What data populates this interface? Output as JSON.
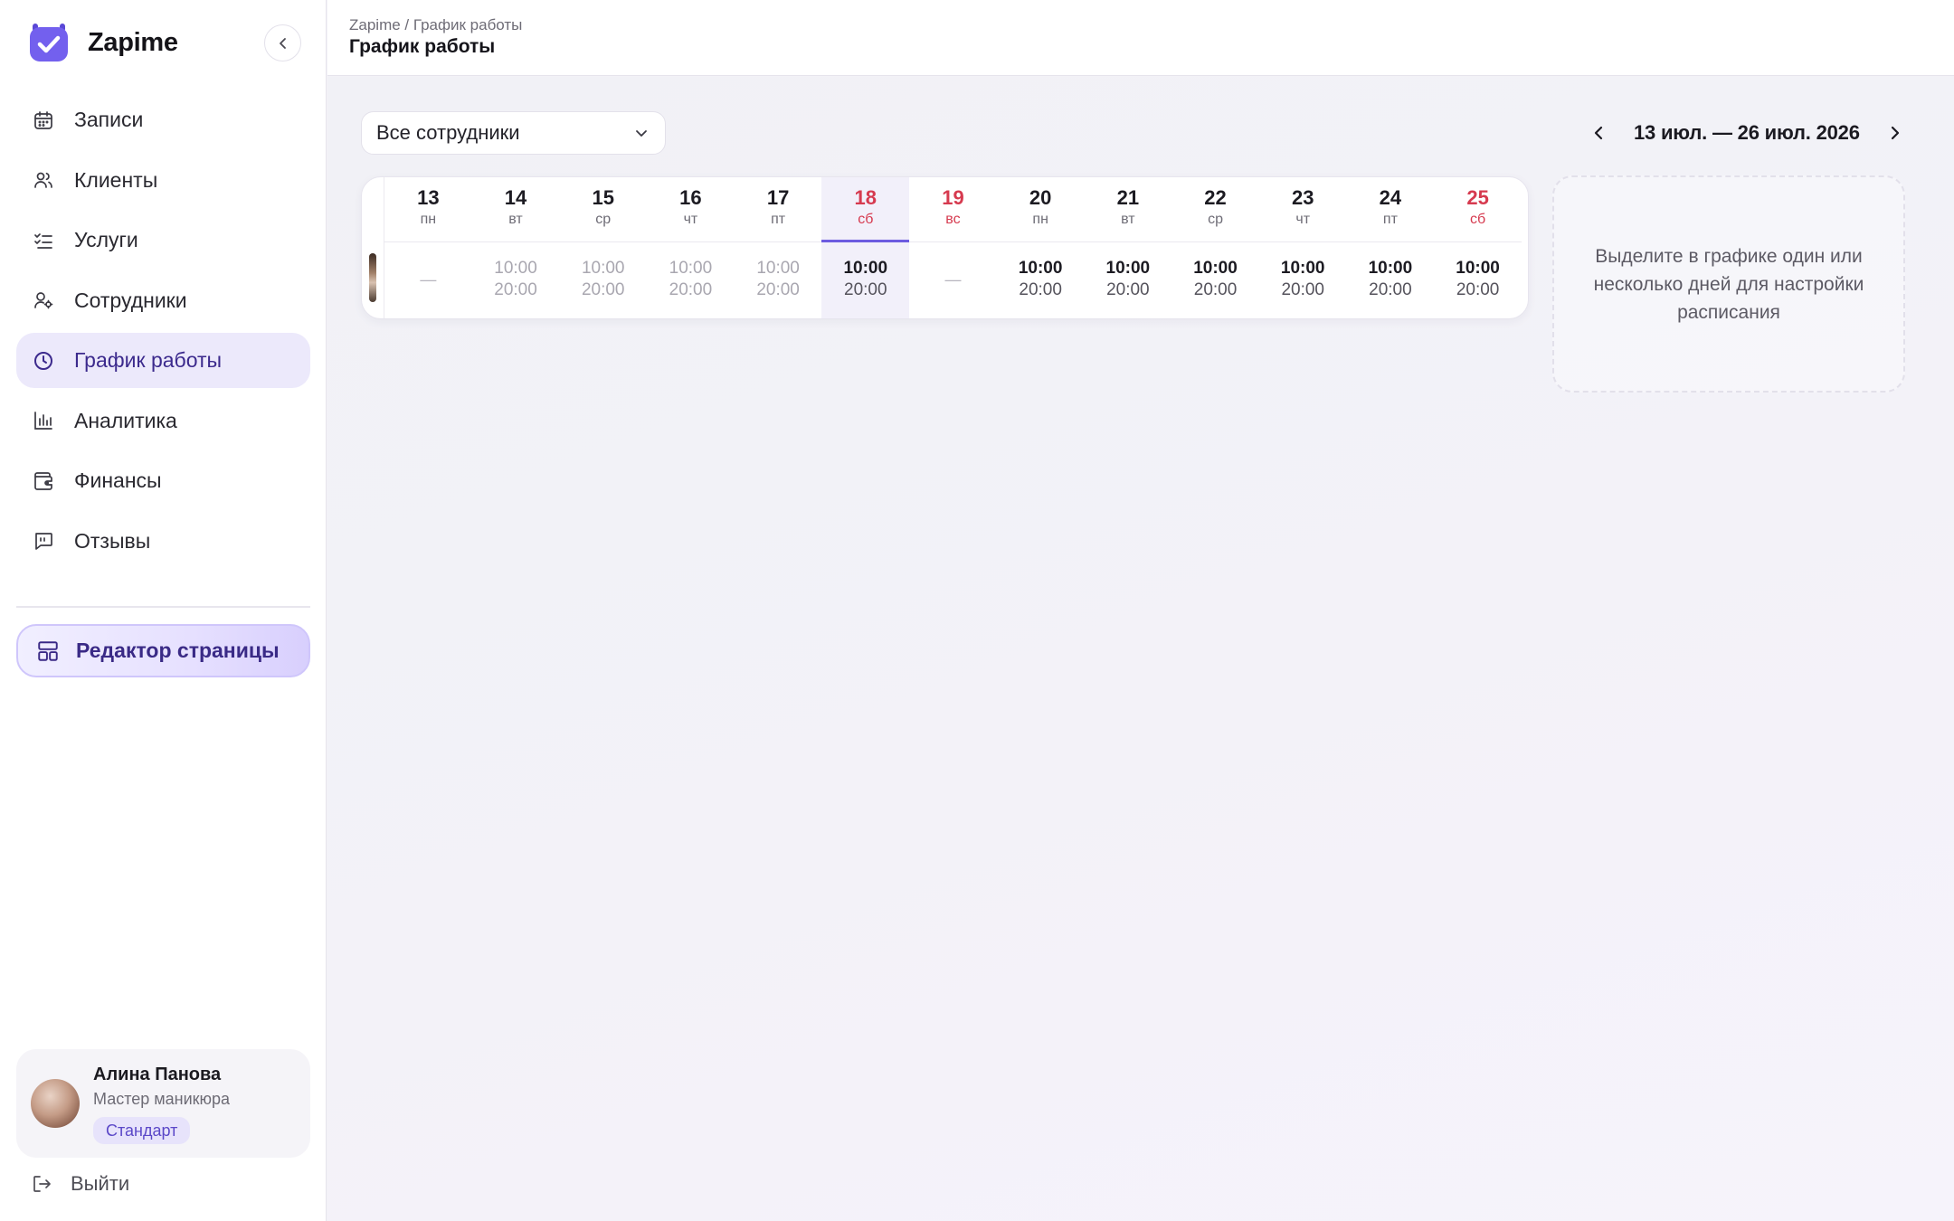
{
  "app": {
    "name": "Zapime"
  },
  "sidebar": {
    "items": [
      {
        "label": "Записи",
        "icon": "calendar-icon",
        "active": false
      },
      {
        "label": "Клиенты",
        "icon": "users-icon",
        "active": false
      },
      {
        "label": "Услуги",
        "icon": "checklist-icon",
        "active": false
      },
      {
        "label": "Сотрудники",
        "icon": "user-settings-icon",
        "active": false
      },
      {
        "label": "График работы",
        "icon": "clock-icon",
        "active": true
      },
      {
        "label": "Аналитика",
        "icon": "bar-chart-icon",
        "active": false
      },
      {
        "label": "Финансы",
        "icon": "wallet-icon",
        "active": false
      },
      {
        "label": "Отзывы",
        "icon": "message-quote-icon",
        "active": false
      }
    ],
    "editor_button": "Редактор страницы",
    "user": {
      "name": "Алина Панова",
      "role": "Мастер маникюра",
      "plan": "Стандарт"
    },
    "logout": "Выйти"
  },
  "header": {
    "breadcrumb": "Zapime / График работы",
    "title": "График работы"
  },
  "filters": {
    "employee_select": "Все сотрудники"
  },
  "range": {
    "label": "13 июл. — 26 июл. 2026"
  },
  "schedule": {
    "days": [
      {
        "num": "13",
        "dow": "пн",
        "start": "",
        "end": "",
        "off": true,
        "past": true,
        "weekend": false,
        "selected": false
      },
      {
        "num": "14",
        "dow": "вт",
        "start": "10:00",
        "end": "20:00",
        "off": false,
        "past": true,
        "weekend": false,
        "selected": false
      },
      {
        "num": "15",
        "dow": "ср",
        "start": "10:00",
        "end": "20:00",
        "off": false,
        "past": true,
        "weekend": false,
        "selected": false
      },
      {
        "num": "16",
        "dow": "чт",
        "start": "10:00",
        "end": "20:00",
        "off": false,
        "past": true,
        "weekend": false,
        "selected": false
      },
      {
        "num": "17",
        "dow": "пт",
        "start": "10:00",
        "end": "20:00",
        "off": false,
        "past": true,
        "weekend": false,
        "selected": false
      },
      {
        "num": "18",
        "dow": "сб",
        "start": "10:00",
        "end": "20:00",
        "off": false,
        "past": false,
        "weekend": true,
        "selected": true
      },
      {
        "num": "19",
        "dow": "вс",
        "start": "",
        "end": "",
        "off": true,
        "past": false,
        "weekend": true,
        "selected": false
      },
      {
        "num": "20",
        "dow": "пн",
        "start": "10:00",
        "end": "20:00",
        "off": false,
        "past": false,
        "weekend": false,
        "selected": false
      },
      {
        "num": "21",
        "dow": "вт",
        "start": "10:00",
        "end": "20:00",
        "off": false,
        "past": false,
        "weekend": false,
        "selected": false
      },
      {
        "num": "22",
        "dow": "ср",
        "start": "10:00",
        "end": "20:00",
        "off": false,
        "past": false,
        "weekend": false,
        "selected": false
      },
      {
        "num": "23",
        "dow": "чт",
        "start": "10:00",
        "end": "20:00",
        "off": false,
        "past": false,
        "weekend": false,
        "selected": false
      },
      {
        "num": "24",
        "dow": "пт",
        "start": "10:00",
        "end": "20:00",
        "off": false,
        "past": false,
        "weekend": false,
        "selected": false
      },
      {
        "num": "25",
        "dow": "сб",
        "start": "10:00",
        "end": "20:00",
        "off": false,
        "past": false,
        "weekend": true,
        "selected": false
      }
    ],
    "off_mark": "—"
  },
  "hint": {
    "text": "Выделите в графике один или несколько дней для настройки расписания"
  },
  "colors": {
    "accent": "#6d5ce0",
    "accent_text": "#3c2a8d",
    "weekend": "#d63a4f",
    "brand_logo": "#6c5ce7"
  }
}
